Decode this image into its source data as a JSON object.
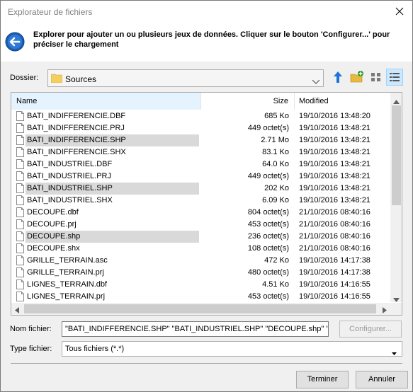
{
  "window": {
    "title": "Explorateur de fichiers"
  },
  "header": {
    "instruction": "Explorer pour ajouter un ou plusieurs jeux de données. Cliquer sur le bouton 'Configurer...' pour préciser le chargement"
  },
  "folder": {
    "label": "Dossier:",
    "value": "Sources"
  },
  "columns": {
    "name": "Name",
    "size": "Size",
    "modified": "Modified"
  },
  "files": [
    {
      "name": "BATI_INDIFFERENCIE.DBF",
      "size": "685 Ko",
      "modified": "19/10/2016 13:48:20",
      "selected": false
    },
    {
      "name": "BATI_INDIFFERENCIE.PRJ",
      "size": "449 octet(s)",
      "modified": "19/10/2016 13:48:21",
      "selected": false
    },
    {
      "name": "BATI_INDIFFERENCIE.SHP",
      "size": "2.71 Mo",
      "modified": "19/10/2016 13:48:21",
      "selected": true
    },
    {
      "name": "BATI_INDIFFERENCIE.SHX",
      "size": "83.1 Ko",
      "modified": "19/10/2016 13:48:21",
      "selected": false
    },
    {
      "name": "BATI_INDUSTRIEL.DBF",
      "size": "64.0 Ko",
      "modified": "19/10/2016 13:48:21",
      "selected": false
    },
    {
      "name": "BATI_INDUSTRIEL.PRJ",
      "size": "449 octet(s)",
      "modified": "19/10/2016 13:48:21",
      "selected": false
    },
    {
      "name": "BATI_INDUSTRIEL.SHP",
      "size": "202 Ko",
      "modified": "19/10/2016 13:48:21",
      "selected": true
    },
    {
      "name": "BATI_INDUSTRIEL.SHX",
      "size": "6.09 Ko",
      "modified": "19/10/2016 13:48:21",
      "selected": false
    },
    {
      "name": "DECOUPE.dbf",
      "size": "804 octet(s)",
      "modified": "21/10/2016 08:40:16",
      "selected": false
    },
    {
      "name": "DECOUPE.prj",
      "size": "453 octet(s)",
      "modified": "21/10/2016 08:40:16",
      "selected": false
    },
    {
      "name": "DECOUPE.shp",
      "size": "236 octet(s)",
      "modified": "21/10/2016 08:40:16",
      "selected": true
    },
    {
      "name": "DECOUPE.shx",
      "size": "108 octet(s)",
      "modified": "21/10/2016 08:40:16",
      "selected": false
    },
    {
      "name": "GRILLE_TERRAIN.asc",
      "size": "472 Ko",
      "modified": "19/10/2016 14:17:38",
      "selected": false
    },
    {
      "name": "GRILLE_TERRAIN.prj",
      "size": "480 octet(s)",
      "modified": "19/10/2016 14:17:38",
      "selected": false
    },
    {
      "name": "LIGNES_TERRAIN.dbf",
      "size": "4.51 Ko",
      "modified": "19/10/2016 14:16:55",
      "selected": false
    },
    {
      "name": "LIGNES_TERRAIN.prj",
      "size": "453 octet(s)",
      "modified": "19/10/2016 14:16:55",
      "selected": false
    }
  ],
  "filename": {
    "label": "Nom fichier:",
    "value": "\"BATI_INDIFFERENCIE.SHP\" \"BATI_INDUSTRIEL.SHP\" \"DECOUPE.shp\" \""
  },
  "filetype": {
    "label": "Type fichier:",
    "value": "Tous fichiers (*.*)"
  },
  "buttons": {
    "configure": "Configurer...",
    "finish": "Terminer",
    "cancel": "Annuler"
  },
  "icons": {
    "close": "close-icon",
    "back": "back-arrow-icon",
    "folder": "folder-icon",
    "up": "up-arrow-icon",
    "new_folder": "new-folder-icon",
    "list_view": "list-view-icon",
    "details_view": "details-view-icon",
    "file": "file-icon"
  },
  "colors": {
    "accent": "#1a5fb4",
    "selection": "#d9d9d9",
    "header_hover": "#e5f3ff"
  }
}
